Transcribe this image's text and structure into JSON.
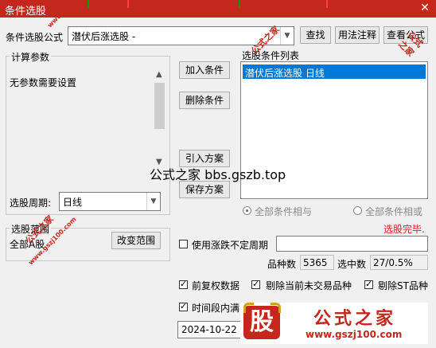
{
  "window": {
    "title": "条件选股",
    "close_glyph": "✕"
  },
  "formula": {
    "label": "条件选股公式",
    "value": "潜伏后涨选股  -"
  },
  "top_buttons": [
    "查找",
    "用法注释",
    "查看公式"
  ],
  "params": {
    "legend": "计算参数",
    "text": "无参数需要设置"
  },
  "period": {
    "label": "选股周期:",
    "value": "日线"
  },
  "range": {
    "legend": "选股范围",
    "value": "全部A股",
    "button": "改变范围"
  },
  "middle_buttons": {
    "add": "加入条件",
    "delete": "删除条件",
    "import": "引入方案",
    "save": "保存方案"
  },
  "conditions": {
    "legend": "选股条件列表",
    "items": [
      "潜伏后涨选股  日线"
    ]
  },
  "logic": {
    "and_label": "全部条件相与",
    "or_label": "全部条件相或"
  },
  "status": {
    "text": "选股完毕.",
    "color": "#e02020"
  },
  "rise_fall": {
    "label": "使用涨跌不定周期"
  },
  "counts": {
    "total_label": "品种数",
    "total_value": "5365",
    "selected_label": "选中数",
    "selected_value": "27/0.5%"
  },
  "options": {
    "fq": "前复权数据",
    "exclude_inactive": "剔除当前未交易品种",
    "exclude_st": "剔除ST品种",
    "time_range": "时间段内满"
  },
  "date": {
    "value": "2024-10-22"
  },
  "watermark": {
    "center": "公式之家 bbs.gszb.top",
    "logo_glyph": "股",
    "logo_text": "公式之家",
    "logo_url": "www.gszj100.com",
    "diag": "公式之家",
    "diag_url": "www.gszj100.com"
  },
  "colors": {
    "titlebar": "#c4281c",
    "selection": "#0078d7"
  }
}
